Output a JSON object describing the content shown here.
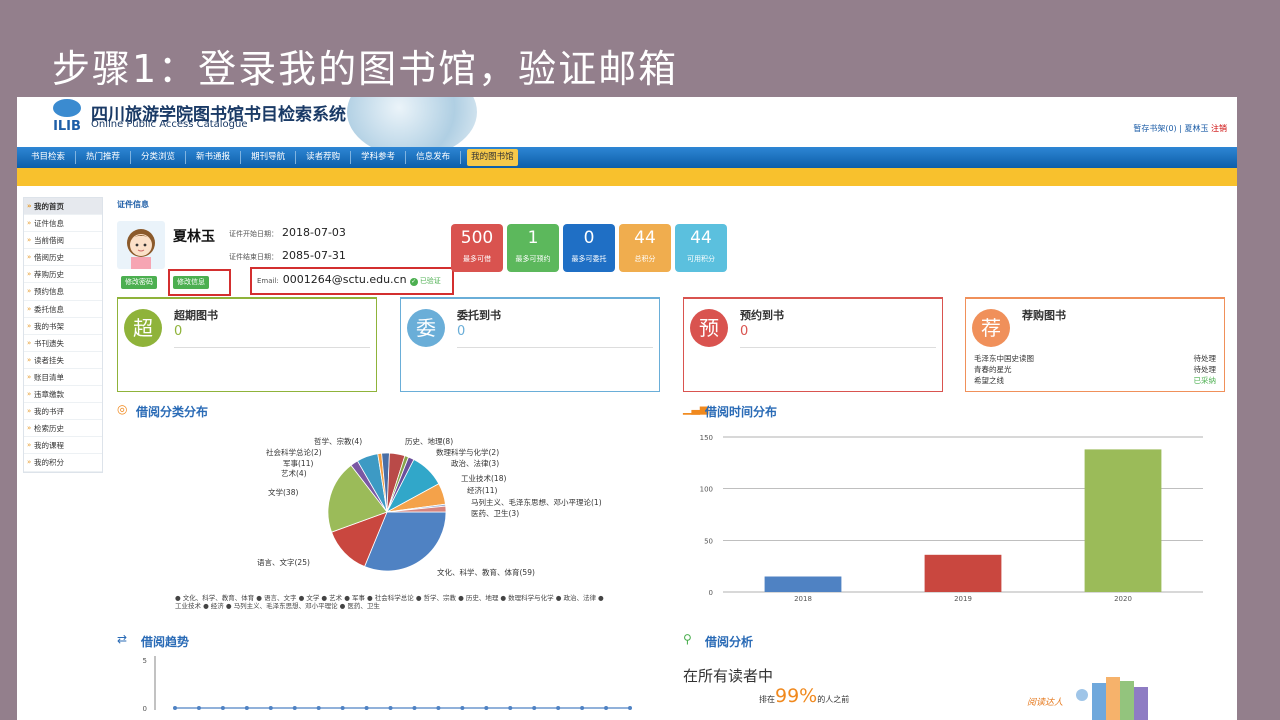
{
  "slide": {
    "title": "步骤1：登录我的图书馆，验证邮箱"
  },
  "header": {
    "logo_text": "ILIB",
    "title": "四川旅游学院图书馆书目检索系统",
    "subtitle": "Online Public Access Catalogue",
    "shelf": "暂存书架(0) |",
    "user": "夏林玉",
    "logout": "注销"
  },
  "nav": [
    "书目检索",
    "热门推荐",
    "分类浏览",
    "新书通报",
    "期刊导航",
    "读者荐购",
    "学科参考",
    "信息发布",
    "我的图书馆"
  ],
  "sidebar": [
    "我的首页",
    "证件信息",
    "当前借阅",
    "借阅历史",
    "荐购历史",
    "预约信息",
    "委托信息",
    "我的书架",
    "书刊遗失",
    "读者挂失",
    "账目清单",
    "违章缴款",
    "我的书评",
    "检索历史",
    "我的课程",
    "我的积分"
  ],
  "card": {
    "label": "证件信息",
    "name": "夏林玉",
    "start_key": "证件开始日期：",
    "start": "2018-07-03",
    "end_key": "证件结束日期：",
    "end": "2085-07-31",
    "email_key": "Email:",
    "email": "0001264@sctu.edu.cn",
    "verified": "已验证",
    "btn_password": "修改密码",
    "btn_info": "修改信息"
  },
  "stats": [
    {
      "num": "500",
      "label": "最多可借",
      "color": "#d9534f"
    },
    {
      "num": "1",
      "label": "最多可预约",
      "color": "#5cb85c"
    },
    {
      "num": "0",
      "label": "最多可委托",
      "color": "#1f6fc5"
    },
    {
      "num": "44",
      "label": "总积分",
      "color": "#f0ad4e"
    },
    {
      "num": "44",
      "label": "可用积分",
      "color": "#5bc0de"
    }
  ],
  "panels": [
    {
      "char": "超",
      "title": "超期图书",
      "value": "0",
      "color": "#8fb33a"
    },
    {
      "char": "委",
      "title": "委托到书",
      "value": "0",
      "color": "#6aaed8"
    },
    {
      "char": "预",
      "title": "预约到书",
      "value": "0",
      "color": "#d9534f"
    },
    {
      "char": "荐",
      "title": "荐购图书",
      "value": "",
      "color": "#f0905a"
    }
  ],
  "recommend": [
    {
      "title": "毛泽东中国史读图",
      "status": "待处理"
    },
    {
      "title": "青春的星光",
      "status": "待处理"
    },
    {
      "title": "希望之线",
      "status": "已采纳"
    }
  ],
  "sections": {
    "category": "借阅分类分布",
    "time": "借阅时间分布",
    "trend": "借阅趋势",
    "analysis": "借阅分析"
  },
  "pie_labels": [
    "哲学、宗教(4)",
    "历史、地理(8)",
    "社会科学总论(2)",
    "数理科学与化学(2)",
    "军事(11)",
    "政治、法律(3)",
    "艺术(4)",
    "工业技术(18)",
    "文学(38)",
    "经济(11)",
    "马列主义、毛泽东思想、邓小平理论(1)",
    "医药、卫生(3)",
    "语言、文字(25)",
    "文化、科学、教育、体育(59)"
  ],
  "pie_legend": "● 文化、科学、教育、体育 ● 语言、文字 ● 文学 ● 艺术 ● 军事 ● 社会科学总论 ● 哲学、宗教 ● 历史、地理 ● 数理科学与化学 ● 政治、法律 ● 工业技术 ● 经济 ● 马列主义、毛泽东思想、邓小平理论 ● 医药、卫生",
  "trend_ticks": [
    "5",
    "0"
  ],
  "analysis": {
    "headline": "在所有读者中",
    "prefix": "排在",
    "pct": "99%",
    "suffix": "的人之前",
    "badge": "阅读达人"
  },
  "chart_data": [
    {
      "type": "pie",
      "title": "借阅分类分布",
      "categories": [
        "文化、科学、教育、体育",
        "语言、文字",
        "文学",
        "艺术",
        "军事",
        "社会科学总论",
        "哲学、宗教",
        "历史、地理",
        "数理科学与化学",
        "政治、法律",
        "工业技术",
        "经济",
        "马列主义、毛泽东思想、邓小平理论",
        "医药、卫生"
      ],
      "values": [
        59,
        25,
        38,
        4,
        11,
        2,
        4,
        8,
        2,
        3,
        18,
        11,
        1,
        3
      ],
      "colors": [
        "#4f82c3",
        "#c9473f",
        "#9bbb59",
        "#7a58a3",
        "#3d9ac4",
        "#f59d3f",
        "#4a6fa5",
        "#b94a48",
        "#87a34b",
        "#6b4f9b",
        "#31a7c9",
        "#f4a24a",
        "#9ab0d8",
        "#d5847f"
      ]
    },
    {
      "type": "bar",
      "title": "借阅时间分布",
      "categories": [
        "2018",
        "2019",
        "2020"
      ],
      "values": [
        15,
        36,
        138
      ],
      "colors": [
        "#4f82c3",
        "#c9473f",
        "#9bbb59"
      ],
      "ylim": [
        0,
        150
      ],
      "yticks": [
        0,
        50,
        100,
        150
      ],
      "grid": true
    },
    {
      "type": "line",
      "title": "借阅趋势",
      "values": [
        0,
        0,
        0,
        0,
        0,
        0,
        0,
        0,
        0,
        0,
        0,
        0,
        0,
        0,
        0,
        0,
        0,
        0,
        0,
        0
      ],
      "ylim": [
        0,
        5
      ]
    }
  ]
}
